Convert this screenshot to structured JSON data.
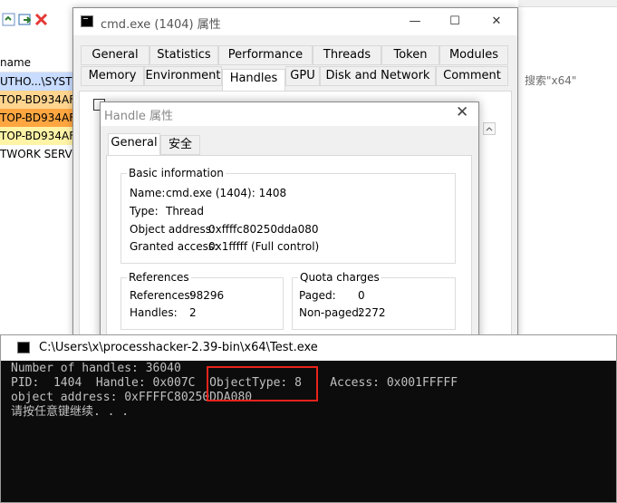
{
  "background": {
    "column_header": "name",
    "processes": [
      {
        "name": "UTHO...\\SYSTE",
        "color": "#c8dcff"
      },
      {
        "name": "TOP-BD934AF",
        "color": "#ffd58f"
      },
      {
        "name": "TOP-BD934AF",
        "color": "#ffa640"
      },
      {
        "name": "TOP-BD934AF",
        "color": "#fff3a6"
      },
      {
        "name": "TWORK SERVI",
        "color": "#ffffff"
      }
    ],
    "search_placeholder": "搜索\"x64\"",
    "toolbar_icons": [
      "refresh-icon",
      "options-icon",
      "find-window-icon",
      "terminate-icon"
    ]
  },
  "properties": {
    "title": "cmd.exe (1404) 属性",
    "tabs_row1": [
      "General",
      "Statistics",
      "Performance",
      "Threads",
      "Token",
      "Modules"
    ],
    "tabs_row2": [
      "Memory",
      "Environment",
      "Handles",
      "GPU",
      "Disk and Network",
      "Comment"
    ],
    "active_tab": "Handles"
  },
  "handle_dialog": {
    "title": "Handle 属性",
    "tabs": [
      "General",
      "安全"
    ],
    "basic": {
      "title": "Basic information",
      "name_label": "Name:",
      "name_value": "cmd.exe (1404): 1408",
      "type_label": "Type:",
      "type_value": "Thread",
      "addr_label": "Object address:",
      "addr_value": "0xffffc80250dda080",
      "access_label": "Granted access:",
      "access_value": "0x1fffff (Full control)"
    },
    "references": {
      "title": "References",
      "refs_label": "References:",
      "refs_value": "98296",
      "handles_label": "Handles:",
      "handles_value": "2"
    },
    "quota": {
      "title": "Quota charges",
      "paged_label": "Paged:",
      "paged_value": "0",
      "nonpaged_label": "Non-paged:",
      "nonpaged_value": "2272"
    }
  },
  "console": {
    "title": "C:\\Users\\x\\processhacker-2.39-bin\\x64\\Test.exe",
    "lines": [
      "Number of handles: 36040",
      "PID:  1404  Handle: 0x007C  ObjectType: 8    Access: 0x001FFFFF",
      "object address: 0xFFFFC80250DDA080",
      "请按任意键继续. . ."
    ],
    "highlight_color": "#e8231b"
  }
}
